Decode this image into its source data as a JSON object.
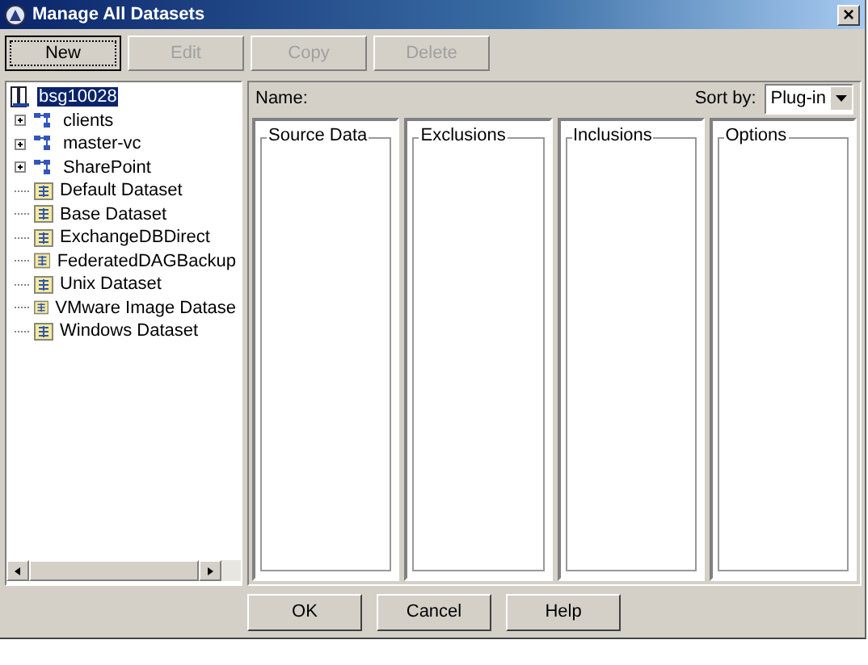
{
  "window": {
    "title": "Manage All Datasets",
    "close": "×"
  },
  "toolbar": [
    {
      "label": "New",
      "disabled": false
    },
    {
      "label": "Edit",
      "disabled": true
    },
    {
      "label": "Copy",
      "disabled": true
    },
    {
      "label": "Delete",
      "disabled": true
    }
  ],
  "tree": {
    "root": {
      "label": "bsg10028",
      "selected": true
    },
    "items": [
      {
        "kind": "group",
        "label": "clients",
        "expandable": true
      },
      {
        "kind": "group",
        "label": "master-vc",
        "expandable": true
      },
      {
        "kind": "group",
        "label": "SharePoint",
        "expandable": true
      },
      {
        "kind": "dataset",
        "label": "Default Dataset",
        "expandable": false
      },
      {
        "kind": "dataset",
        "label": "Base Dataset",
        "expandable": false
      },
      {
        "kind": "dataset",
        "label": "ExchangeDBDirect",
        "expandable": false
      },
      {
        "kind": "dataset",
        "label": "FederatedDAGBackup",
        "expandable": false
      },
      {
        "kind": "dataset",
        "label": "Unix Dataset",
        "expandable": false
      },
      {
        "kind": "dataset",
        "label": "VMware Image Datase",
        "expandable": false
      },
      {
        "kind": "dataset",
        "label": "Windows Dataset",
        "expandable": false
      }
    ]
  },
  "details": {
    "name_label": "Name:",
    "sort_label": "Sort by:",
    "sort_value": "Plug-in",
    "panels": [
      "Source Data",
      "Exclusions",
      "Inclusions",
      "Options"
    ]
  },
  "buttons": [
    "OK",
    "Cancel",
    "Help"
  ]
}
